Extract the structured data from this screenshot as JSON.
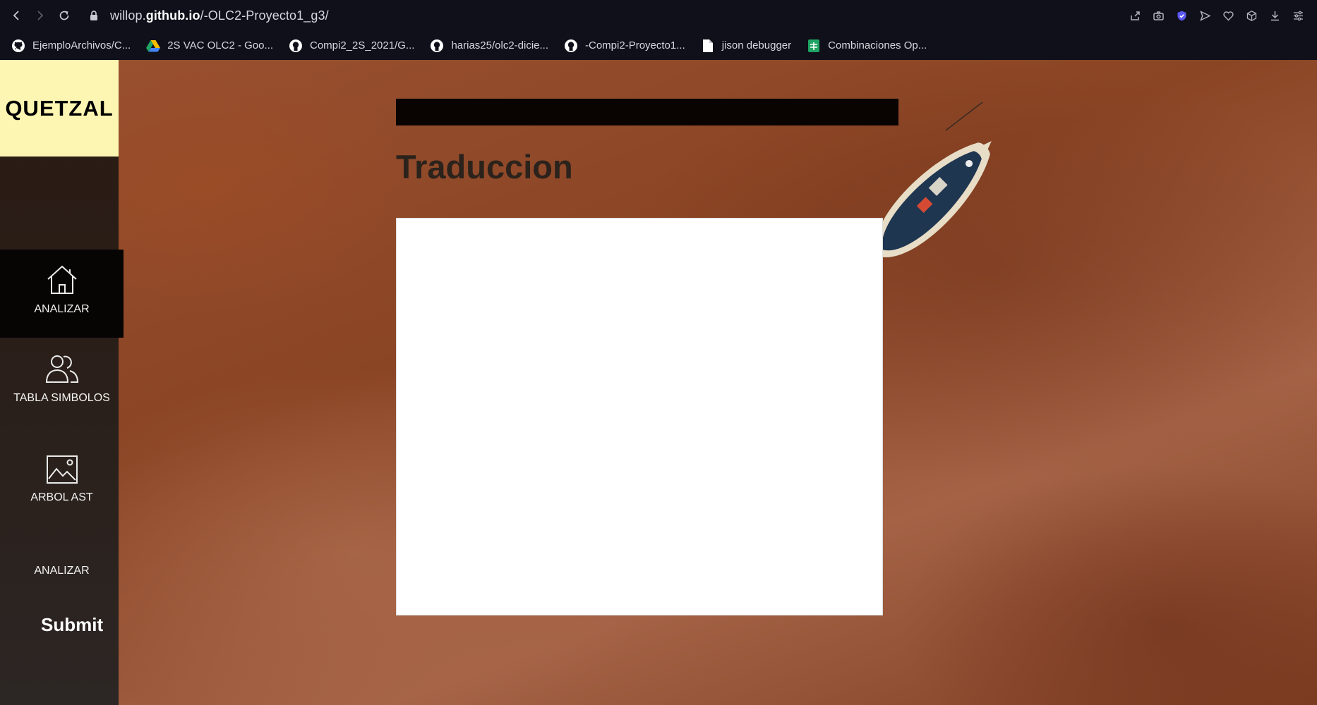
{
  "browser": {
    "url_prefix": "willop.",
    "url_domain": "github.io",
    "url_path": "/-OLC2-Proyecto1_g3/",
    "bookmarks": [
      {
        "label": "EjemploArchivos/C...",
        "icon": "github-icon"
      },
      {
        "label": "2S VAC OLC2 - Goo...",
        "icon": "google-drive-icon"
      },
      {
        "label": "Compi2_2S_2021/G...",
        "icon": "github-icon"
      },
      {
        "label": "harias25/olc2-dicie...",
        "icon": "github-icon"
      },
      {
        "label": "-Compi2-Proyecto1...",
        "icon": "github-icon"
      },
      {
        "label": "jison debugger",
        "icon": "document-icon"
      },
      {
        "label": "Combinaciones Op...",
        "icon": "google-sheets-icon"
      }
    ]
  },
  "app": {
    "brand": "QUETZAL",
    "menu": [
      {
        "label": "ANALIZAR",
        "icon": "home-icon",
        "active": true
      },
      {
        "label": "TABLA SIMBOLOS",
        "icon": "users-icon",
        "active": false
      },
      {
        "label": "ARBOL AST",
        "icon": "image-icon",
        "active": false
      }
    ],
    "side_link": "ANALIZAR",
    "submit_label": "Submit"
  },
  "main": {
    "section_title": "Traduccion",
    "editor_value": ""
  }
}
